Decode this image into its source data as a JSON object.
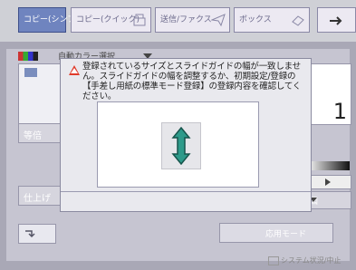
{
  "tabs": [
    {
      "label": "コピー(シンプル)"
    },
    {
      "label": "コピー(クイック)"
    },
    {
      "label": "送信/ファクス"
    },
    {
      "label": "ボックス"
    }
  ],
  "color_mode": {
    "label": "自動カラー選択"
  },
  "side": {
    "magnify": "等倍",
    "finishing": "仕上げ"
  },
  "right": {
    "count": "1",
    "button2": "図"
  },
  "special_mode": {
    "label": "応用モード"
  },
  "dialog": {
    "message": "登録されているサイズとスライドガイドの幅が一致しません。スライドガイドの幅を調整するか、初期設定/登録の【手差し用紙の標準モード登録】の登録内容を確認してください。"
  },
  "system_status": {
    "label": "システム状況/中止"
  },
  "colors": {
    "accent": "#6f84bf",
    "warning": "#e03a2a",
    "arrow": "#2e9a8a"
  }
}
